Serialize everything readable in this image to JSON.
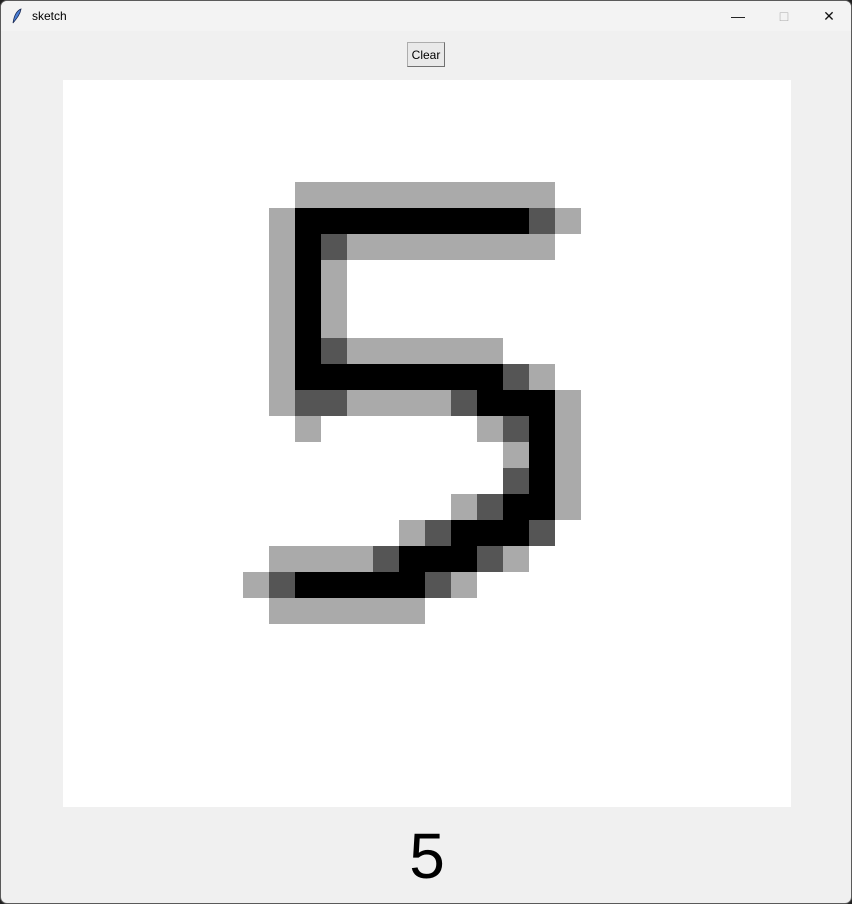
{
  "window": {
    "title": "sketch",
    "icon": "feather-icon"
  },
  "toolbar": {
    "clear_label": "Clear"
  },
  "canvas": {
    "grid_size": 28,
    "colors": {
      "1": "#aaaaaa",
      "2": "#555555",
      "3": "#000000"
    },
    "rows": [
      "0000000000000000000000000000",
      "0000000000000000000000000000",
      "0000000000000000000000000000",
      "0000000000000000000000000000",
      "0000000001111111111000000000",
      "0000000013333333332100000000",
      "0000000013211111111000000000",
      "0000000013100000000000000000",
      "0000000013100000000000000000",
      "0000000013100000000000000000",
      "0000000013211111100000000000",
      "0000000013333333321000000000",
      "0000000012211112333100000000",
      "0000000001000000123100000000",
      "0000000000000000013100000000",
      "0000000000000000023100000000",
      "0000000000000001233100000000",
      "0000000000000123332000000000",
      "0000000011112333210000000000",
      "0000000123333321000000000000",
      "0000000011111100000000000000",
      "0000000000000000000000000000",
      "0000000000000000000000000000",
      "0000000000000000000000000000",
      "0000000000000000000000000000",
      "0000000000000000000000000000",
      "0000000000000000000000000000",
      "0000000000000000000000000000"
    ]
  },
  "prediction": {
    "label": "5"
  }
}
